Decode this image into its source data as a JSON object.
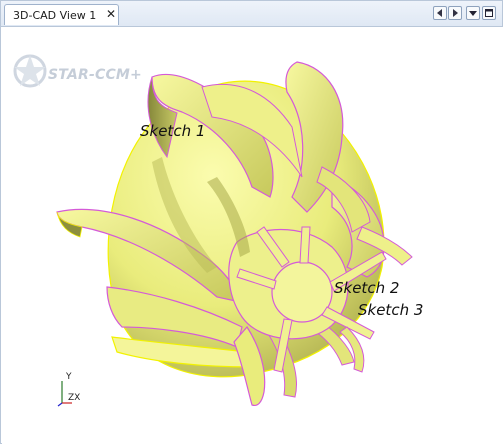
{
  "tab": {
    "title": "3D-CAD View 1",
    "close_glyph": "✕"
  },
  "nav": {
    "prev_icon": "chevron-left-icon",
    "next_icon": "chevron-right-icon",
    "menu_icon": "dropdown-icon",
    "maximize_icon": "maximize-icon"
  },
  "logo": {
    "text": "STAR-CCM+"
  },
  "sketches": [
    "Sketch 1",
    "Sketch 2",
    "Sketch 3"
  ],
  "triad": {
    "y": "Y",
    "zx": "ZX"
  },
  "colors": {
    "surface": "#eef08a",
    "edge_magenta": "#d45ad8",
    "edge_yellow": "#f2f200",
    "shadow": "#9a9a3c"
  }
}
